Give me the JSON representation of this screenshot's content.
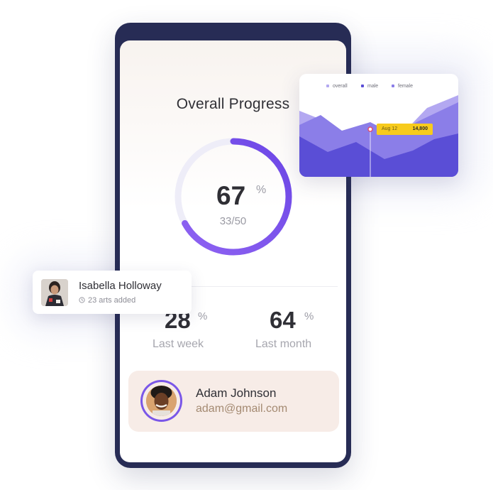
{
  "progress_screen": {
    "title": "Overall Progress",
    "percent": "67",
    "percent_unit": "%",
    "fraction": "33/50",
    "progress_value": 0.67
  },
  "stats": [
    {
      "value": "28",
      "unit": "%",
      "label": "Last week"
    },
    {
      "value": "64",
      "unit": "%",
      "label": "Last month"
    }
  ],
  "user": {
    "name": "Adam Johnson",
    "email": "adam@gmail.com"
  },
  "profile_card": {
    "name": "Isabella Holloway",
    "subtitle": "23 arts added"
  },
  "chart_data": {
    "type": "area",
    "legend": [
      "overall",
      "male",
      "female"
    ],
    "series_colors": {
      "overall": "#a99ef0",
      "male": "#5b4fd6",
      "female": "#8c7fe8"
    },
    "tooltip": {
      "label": "Aug 12",
      "value": "14,800"
    }
  },
  "colors": {
    "accent": "#7a57e8",
    "phone_frame": "#272c55",
    "tooltip": "#f7cb1c"
  },
  "icons": {
    "clock": "clock-icon",
    "avatar": "avatar-photo"
  }
}
